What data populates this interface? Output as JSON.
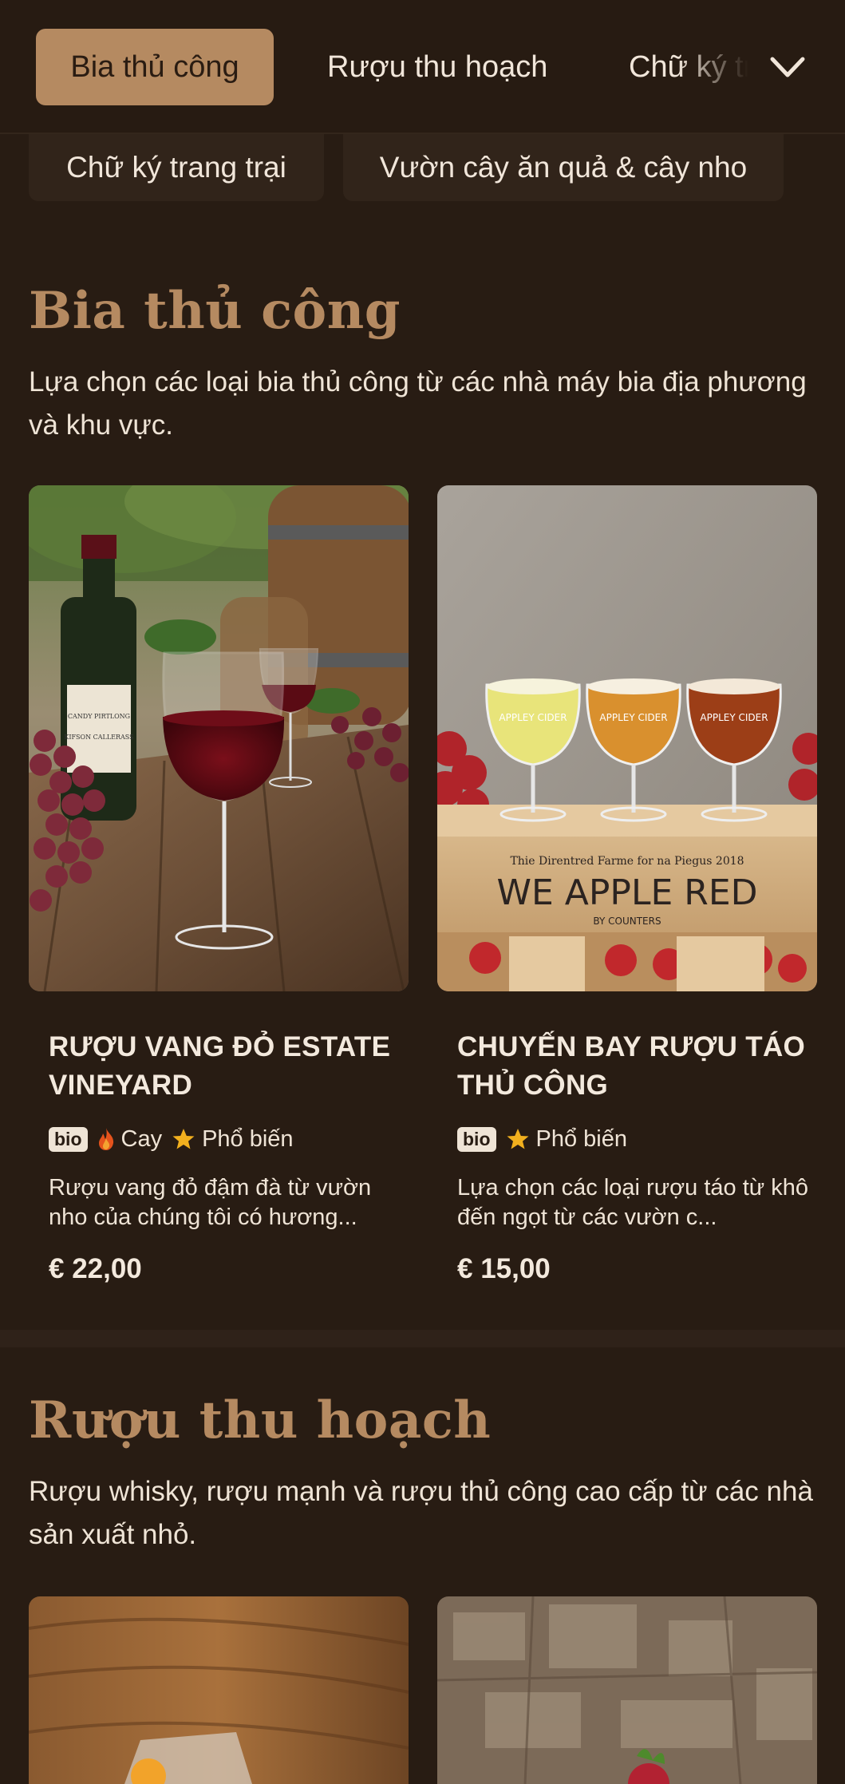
{
  "tabs": {
    "items": [
      "Bia thủ công",
      "Rượu thu hoạch",
      "Chữ ký trang trại"
    ],
    "active_index": 0
  },
  "chips": [
    "Chữ ký trang trại",
    "Vườn cây ăn quả & cây nho"
  ],
  "sections": [
    {
      "title": "Bia thủ công",
      "description": "Lựa chọn các loại bia thủ công từ các nhà máy bia địa phương và khu vực.",
      "products": [
        {
          "title": "RƯỢU VANG ĐỎ ESTATE VINEYARD",
          "badge": "bio",
          "tags": [
            "Cay",
            "Phổ biến"
          ],
          "description": "Rượu vang đỏ đậm đà từ vườn nho của chúng tôi có hương...",
          "price": "€ 22,00",
          "image_label": {
            "bottle": "CANDY PIRTLONG",
            "sub": "KIFSON CALLERASS"
          }
        },
        {
          "title": "CHUYẾN BAY RƯỢU TÁO THỦ CÔNG",
          "badge": "bio",
          "tags": [
            "Phổ biến"
          ],
          "description": "Lựa chọn các loại rượu táo từ khô đến ngọt từ các vườn c...",
          "price": "€ 15,00",
          "image_label": {
            "top": "Thie Direntred Farme for na Piegus 2018",
            "big": "WE APPLE RED",
            "small": "BY COUNTERS",
            "glass": "APPLEY CIDER"
          }
        }
      ]
    },
    {
      "title": "Rượu thu hoạch",
      "description": "Rượu whisky, rượu mạnh và rượu thủ công cao cấp từ các nhà sản xuất nhỏ."
    }
  ],
  "icons": {
    "dropdown": "chevron-down-icon",
    "spicy": "fire-icon",
    "popular": "star-icon"
  },
  "colors": {
    "background": "#281c13",
    "accent": "#b58a61",
    "star": "#f2b01e",
    "fire": "#e5531c"
  }
}
